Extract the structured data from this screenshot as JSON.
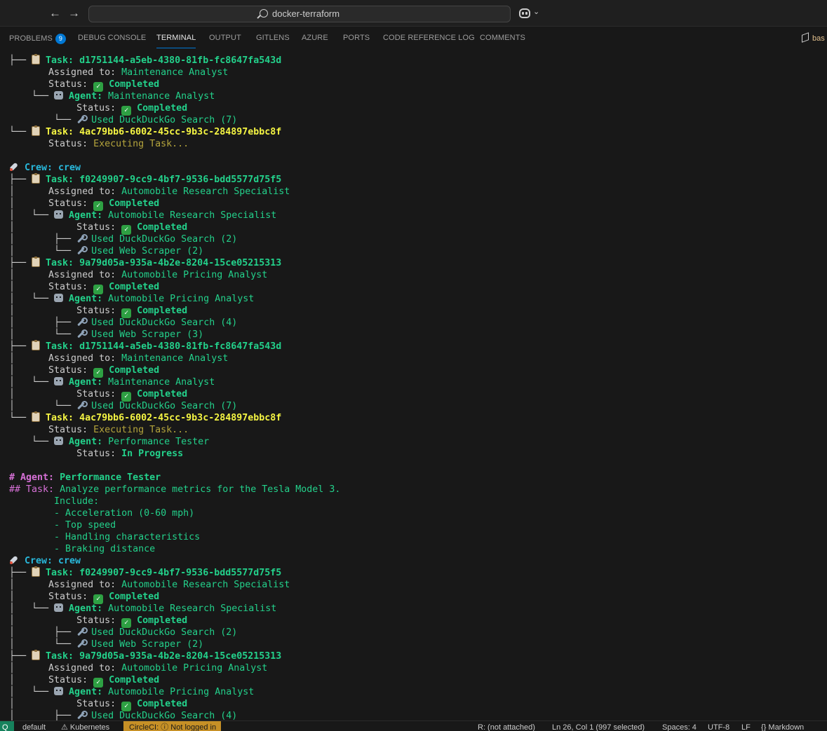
{
  "titlebar": {
    "back_glyph": "←",
    "forward_glyph": "→",
    "search_text": "docker-terraform",
    "copilot_chevron": "⌄"
  },
  "panel_tabs": [
    {
      "label": "PROBLEMS",
      "badge": "9"
    },
    {
      "label": "DEBUG CONSOLE"
    },
    {
      "label": "TERMINAL",
      "active": true
    },
    {
      "label": "OUTPUT"
    },
    {
      "label": "GITLENS"
    },
    {
      "label": "AZURE"
    },
    {
      "label": "PORTS"
    },
    {
      "label": "CODE REFERENCE LOG"
    },
    {
      "label": "COMMENTS"
    }
  ],
  "terminal_selector": "bas",
  "terminal": {
    "lines": [
      [
        {
          "t": "├── ",
          "c": "tree"
        },
        {
          "i": "clip"
        },
        {
          "t": " Task: d1751144-a5eb-4380-81fb-fc8647fa543d",
          "c": "task-g"
        }
      ],
      [
        {
          "t": "       Assigned to: ",
          "c": "gray"
        },
        {
          "t": "Maintenance Analyst",
          "c": "green"
        }
      ],
      [
        {
          "t": "       Status: ",
          "c": "gray"
        },
        {
          "i": "check"
        },
        {
          "t": " Completed",
          "c": "green-b"
        }
      ],
      [
        {
          "t": "    └── ",
          "c": "tree"
        },
        {
          "i": "robot"
        },
        {
          "t": " Agent: ",
          "c": "green-b"
        },
        {
          "t": "Maintenance Analyst",
          "c": "green"
        }
      ],
      [
        {
          "t": "            Status: ",
          "c": "gray"
        },
        {
          "i": "check"
        },
        {
          "t": " Completed",
          "c": "green-b"
        }
      ],
      [
        {
          "t": "        └── ",
          "c": "tree"
        },
        {
          "i": "wrench"
        },
        {
          "t": " Used DuckDuckGo Search (7)",
          "c": "green"
        }
      ],
      [
        {
          "t": "└── ",
          "c": "tree"
        },
        {
          "i": "clip"
        },
        {
          "t": " Task: 4ac79bb6-6002-45cc-9b3c-284897ebbc8f",
          "c": "task-y"
        }
      ],
      [
        {
          "t": "       Status: ",
          "c": "gray"
        },
        {
          "t": "Executing Task...",
          "c": "olive"
        }
      ],
      [],
      [
        {
          "i": "rocket"
        },
        {
          "t": " Crew: crew",
          "c": "cyan-b"
        }
      ],
      [
        {
          "t": "├── ",
          "c": "tree"
        },
        {
          "i": "clip"
        },
        {
          "t": " Task: f0249907-9cc9-4bf7-9536-bdd5577d75f5",
          "c": "task-g"
        }
      ],
      [
        {
          "t": "│      Assigned to: ",
          "c": "gray"
        },
        {
          "t": "Automobile Research Specialist",
          "c": "green"
        }
      ],
      [
        {
          "t": "│      Status: ",
          "c": "gray"
        },
        {
          "i": "check"
        },
        {
          "t": " Completed",
          "c": "green-b"
        }
      ],
      [
        {
          "t": "│   └── ",
          "c": "tree"
        },
        {
          "i": "robot"
        },
        {
          "t": " Agent: ",
          "c": "green-b"
        },
        {
          "t": "Automobile Research Specialist",
          "c": "green"
        }
      ],
      [
        {
          "t": "│           Status: ",
          "c": "gray"
        },
        {
          "i": "check"
        },
        {
          "t": " Completed",
          "c": "green-b"
        }
      ],
      [
        {
          "t": "│       ├── ",
          "c": "tree"
        },
        {
          "i": "wrench"
        },
        {
          "t": " Used DuckDuckGo Search (2)",
          "c": "green"
        }
      ],
      [
        {
          "t": "│       └── ",
          "c": "tree"
        },
        {
          "i": "wrench"
        },
        {
          "t": " Used Web Scraper (2)",
          "c": "green"
        }
      ],
      [
        {
          "t": "├── ",
          "c": "tree"
        },
        {
          "i": "clip"
        },
        {
          "t": " Task: 9a79d05a-935a-4b2e-8204-15ce05215313",
          "c": "task-g"
        }
      ],
      [
        {
          "t": "│      Assigned to: ",
          "c": "gray"
        },
        {
          "t": "Automobile Pricing Analyst",
          "c": "green"
        }
      ],
      [
        {
          "t": "│      Status: ",
          "c": "gray"
        },
        {
          "i": "check"
        },
        {
          "t": " Completed",
          "c": "green-b"
        }
      ],
      [
        {
          "t": "│   └── ",
          "c": "tree"
        },
        {
          "i": "robot"
        },
        {
          "t": " Agent: ",
          "c": "green-b"
        },
        {
          "t": "Automobile Pricing Analyst",
          "c": "green"
        }
      ],
      [
        {
          "t": "│           Status: ",
          "c": "gray"
        },
        {
          "i": "check"
        },
        {
          "t": " Completed",
          "c": "green-b"
        }
      ],
      [
        {
          "t": "│       ├── ",
          "c": "tree"
        },
        {
          "i": "wrench"
        },
        {
          "t": " Used DuckDuckGo Search (4)",
          "c": "green"
        }
      ],
      [
        {
          "t": "│       └── ",
          "c": "tree"
        },
        {
          "i": "wrench"
        },
        {
          "t": " Used Web Scraper (3)",
          "c": "green"
        }
      ],
      [
        {
          "t": "├── ",
          "c": "tree"
        },
        {
          "i": "clip"
        },
        {
          "t": " Task: d1751144-a5eb-4380-81fb-fc8647fa543d",
          "c": "task-g"
        }
      ],
      [
        {
          "t": "│      Assigned to: ",
          "c": "gray"
        },
        {
          "t": "Maintenance Analyst",
          "c": "green"
        }
      ],
      [
        {
          "t": "│      Status: ",
          "c": "gray"
        },
        {
          "i": "check"
        },
        {
          "t": " Completed",
          "c": "green-b"
        }
      ],
      [
        {
          "t": "│   └── ",
          "c": "tree"
        },
        {
          "i": "robot"
        },
        {
          "t": " Agent: ",
          "c": "green-b"
        },
        {
          "t": "Maintenance Analyst",
          "c": "green"
        }
      ],
      [
        {
          "t": "│           Status: ",
          "c": "gray"
        },
        {
          "i": "check"
        },
        {
          "t": " Completed",
          "c": "green-b"
        }
      ],
      [
        {
          "t": "│       └── ",
          "c": "tree"
        },
        {
          "i": "wrench"
        },
        {
          "t": " Used DuckDuckGo Search (7)",
          "c": "green"
        }
      ],
      [
        {
          "t": "└── ",
          "c": "tree"
        },
        {
          "i": "clip"
        },
        {
          "t": " Task: 4ac79bb6-6002-45cc-9b3c-284897ebbc8f",
          "c": "task-y"
        }
      ],
      [
        {
          "t": "       Status: ",
          "c": "gray"
        },
        {
          "t": "Executing Task...",
          "c": "olive"
        }
      ],
      [
        {
          "t": "    └── ",
          "c": "tree"
        },
        {
          "i": "robot"
        },
        {
          "t": " Agent: ",
          "c": "green-b"
        },
        {
          "t": "Performance Tester",
          "c": "green"
        }
      ],
      [
        {
          "t": "            Status: ",
          "c": "gray"
        },
        {
          "t": "In Progress",
          "c": "green-b"
        }
      ],
      [],
      [
        {
          "t": "# Agent: ",
          "c": "magenta-b"
        },
        {
          "t": "Performance Tester",
          "c": "green-b"
        }
      ],
      [
        {
          "t": "## Task: ",
          "c": "magenta"
        },
        {
          "t": "Analyze performance metrics for the Tesla Model 3.",
          "c": "green"
        }
      ],
      [
        {
          "t": "        Include:",
          "c": "green"
        }
      ],
      [
        {
          "t": "        - Acceleration (0-60 mph)",
          "c": "green"
        }
      ],
      [
        {
          "t": "        - Top speed",
          "c": "green"
        }
      ],
      [
        {
          "t": "        - Handling characteristics",
          "c": "green"
        }
      ],
      [
        {
          "t": "        - Braking distance",
          "c": "green"
        }
      ],
      [
        {
          "i": "rocket"
        },
        {
          "t": " Crew: crew",
          "c": "cyan-b"
        }
      ],
      [
        {
          "t": "├── ",
          "c": "tree"
        },
        {
          "i": "clip"
        },
        {
          "t": " Task: f0249907-9cc9-4bf7-9536-bdd5577d75f5",
          "c": "task-g"
        }
      ],
      [
        {
          "t": "│      Assigned to: ",
          "c": "gray"
        },
        {
          "t": "Automobile Research Specialist",
          "c": "green"
        }
      ],
      [
        {
          "t": "│      Status: ",
          "c": "gray"
        },
        {
          "i": "check"
        },
        {
          "t": " Completed",
          "c": "green-b"
        }
      ],
      [
        {
          "t": "│   └── ",
          "c": "tree"
        },
        {
          "i": "robot"
        },
        {
          "t": " Agent: ",
          "c": "green-b"
        },
        {
          "t": "Automobile Research Specialist",
          "c": "green"
        }
      ],
      [
        {
          "t": "│           Status: ",
          "c": "gray"
        },
        {
          "i": "check"
        },
        {
          "t": " Completed",
          "c": "green-b"
        }
      ],
      [
        {
          "t": "│       ├── ",
          "c": "tree"
        },
        {
          "i": "wrench"
        },
        {
          "t": " Used DuckDuckGo Search (2)",
          "c": "green"
        }
      ],
      [
        {
          "t": "│       └── ",
          "c": "tree"
        },
        {
          "i": "wrench"
        },
        {
          "t": " Used Web Scraper (2)",
          "c": "green"
        }
      ],
      [
        {
          "t": "├── ",
          "c": "tree"
        },
        {
          "i": "clip"
        },
        {
          "t": " Task: 9a79d05a-935a-4b2e-8204-15ce05215313",
          "c": "task-g"
        }
      ],
      [
        {
          "t": "│      Assigned to: ",
          "c": "gray"
        },
        {
          "t": "Automobile Pricing Analyst",
          "c": "green"
        }
      ],
      [
        {
          "t": "│      Status: ",
          "c": "gray"
        },
        {
          "i": "check"
        },
        {
          "t": " Completed",
          "c": "green-b"
        }
      ],
      [
        {
          "t": "│   └── ",
          "c": "tree"
        },
        {
          "i": "robot"
        },
        {
          "t": " Agent: ",
          "c": "green-b"
        },
        {
          "t": "Automobile Pricing Analyst",
          "c": "green"
        }
      ],
      [
        {
          "t": "│           Status: ",
          "c": "gray"
        },
        {
          "i": "check"
        },
        {
          "t": " Completed",
          "c": "green-b"
        }
      ],
      [
        {
          "t": "│       ├── ",
          "c": "tree"
        },
        {
          "i": "wrench"
        },
        {
          "t": " Used DuckDuckGo Search (4)",
          "c": "green"
        }
      ]
    ]
  },
  "statusbar": {
    "remote": "Q",
    "profile": "default",
    "kubernetes": "⚠ Kubernetes",
    "circleci": "CircleCI: ⓘ Not logged in",
    "attach": "R: (not attached)",
    "cursor": "Ln 26, Col 1 (997 selected)",
    "spaces": "Spaces: 4",
    "encoding": "UTF-8",
    "eol": "LF",
    "language": "{} Markdown"
  }
}
